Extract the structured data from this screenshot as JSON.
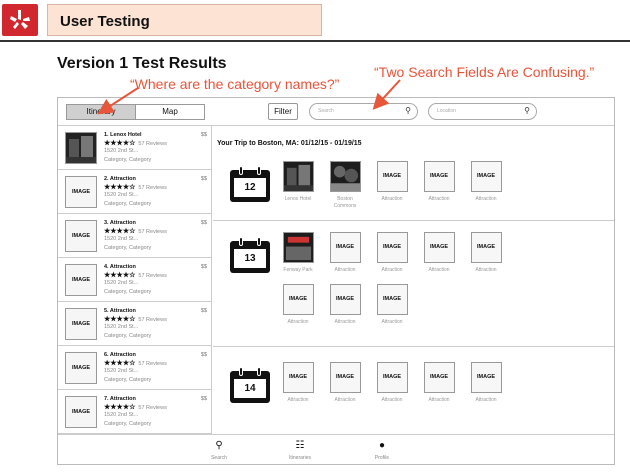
{
  "header": {
    "title": "User Testing",
    "logo_icon": "yelp-burst-icon",
    "accent": "#d0282e"
  },
  "page_title": "Version 1 Test Results",
  "annotations": [
    "“Where are the category names?”",
    "“Two Search Fields Are Confusing.”"
  ],
  "annotation_color": "#e7553b",
  "toolbar": {
    "view_toggle": [
      "Itinerary",
      "Map"
    ],
    "filter_label": "Filter",
    "search_placeholder": "Search",
    "location_placeholder": "Location"
  },
  "sidebar": {
    "items": [
      {
        "name": "1. Lenox Hotel",
        "price": "$$",
        "reviews": "57 Reviews",
        "address": "1520 2nd St...",
        "category": "Category, Category",
        "image": ""
      },
      {
        "name": "2. Attraction",
        "price": "$$",
        "reviews": "57 Reviews",
        "address": "1520 2nd St...",
        "category": "Category, Category",
        "image": "IMAGE"
      },
      {
        "name": "3. Attraction",
        "price": "$$",
        "reviews": "57 Reviews",
        "address": "1520 2nd St...",
        "category": "Category, Category",
        "image": "IMAGE"
      },
      {
        "name": "4. Attraction",
        "price": "$$",
        "reviews": "57 Reviews",
        "address": "1520 2nd St...",
        "category": "Category, Category",
        "image": "IMAGE"
      },
      {
        "name": "5. Attraction",
        "price": "$$",
        "reviews": "57 Reviews",
        "address": "1520 2nd St...",
        "category": "Category, Category",
        "image": "IMAGE"
      },
      {
        "name": "6. Attraction",
        "price": "$$",
        "reviews": "57 Reviews",
        "address": "1520 2nd St...",
        "category": "Category, Category",
        "image": "IMAGE"
      },
      {
        "name": "7. Attraction",
        "price": "$$",
        "reviews": "57 Reviews",
        "address": "1520 2nd St...",
        "category": "Category, Category",
        "image": "IMAGE"
      }
    ],
    "stars": "★★★★☆"
  },
  "trip": {
    "title": "Your Trip to Boston, MA: 01/12/15 - 01/19/15",
    "days": [
      {
        "date": "12",
        "tiles": [
          {
            "label": "Lenox Hotel",
            "image": ""
          },
          {
            "label": "Boston Commons",
            "image": ""
          },
          {
            "label": "Attraction",
            "image": "IMAGE"
          },
          {
            "label": "Attraction",
            "image": "IMAGE"
          },
          {
            "label": "Attraction",
            "image": "IMAGE"
          }
        ]
      },
      {
        "date": "13",
        "tiles": [
          {
            "label": "Fenway Park",
            "image": ""
          },
          {
            "label": "Attraction",
            "image": "IMAGE"
          },
          {
            "label": "Attraction",
            "image": "IMAGE"
          },
          {
            "label": "Attraction",
            "image": "IMAGE"
          },
          {
            "label": "Attraction",
            "image": "IMAGE"
          },
          {
            "label": "Attraction",
            "image": "IMAGE"
          },
          {
            "label": "Attraction",
            "image": "IMAGE"
          },
          {
            "label": "Attraction",
            "image": "IMAGE"
          }
        ]
      },
      {
        "date": "14",
        "tiles": [
          {
            "label": "Attraction",
            "image": "IMAGE"
          },
          {
            "label": "Attraction",
            "image": "IMAGE"
          },
          {
            "label": "Attraction",
            "image": "IMAGE"
          },
          {
            "label": "Attraction",
            "image": "IMAGE"
          },
          {
            "label": "Attraction",
            "image": "IMAGE"
          }
        ]
      }
    ]
  },
  "bottom_tabs": [
    {
      "label": "Search",
      "icon": "search-icon"
    },
    {
      "label": "Itineraries",
      "icon": "itinerary-icon"
    },
    {
      "label": "Profile",
      "icon": "profile-icon"
    }
  ]
}
